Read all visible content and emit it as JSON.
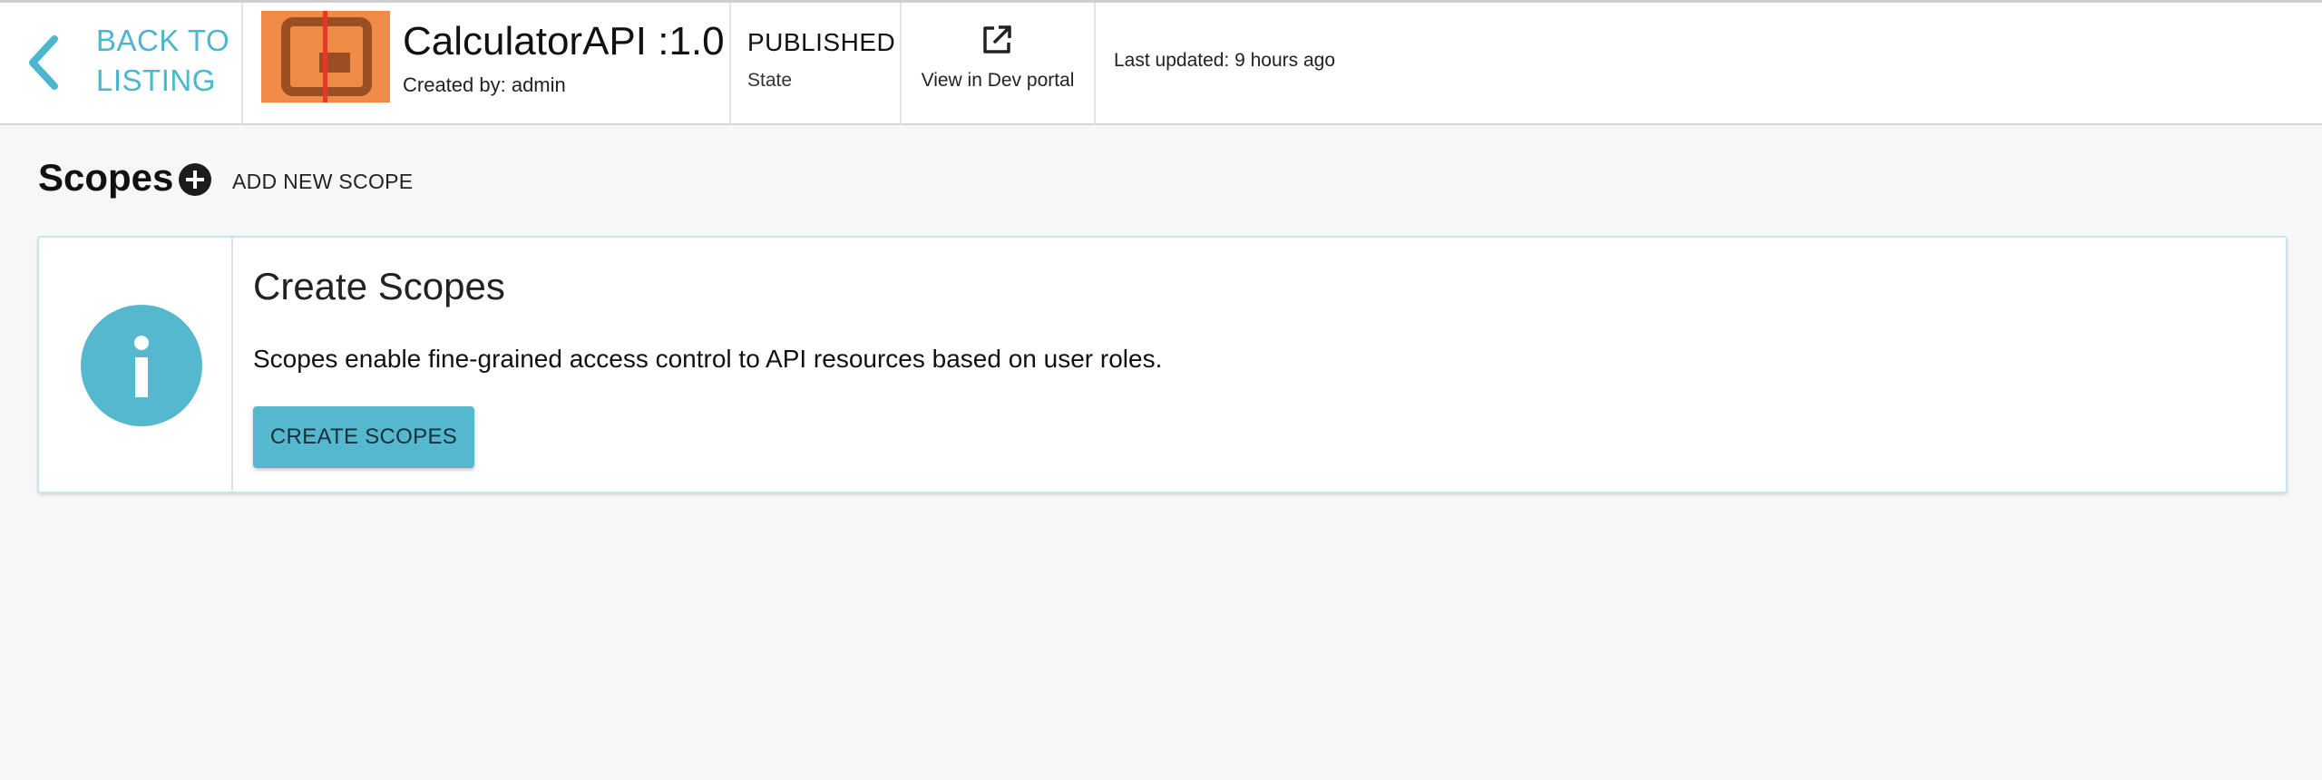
{
  "header": {
    "back_label_line1": "BACK TO",
    "back_label_line2": "LISTING",
    "api_name": "CalculatorAPI :1.0",
    "created_by": "Created by: admin",
    "state_value": "PUBLISHED",
    "state_label": "State",
    "dev_portal_label": "View in Dev portal",
    "last_updated": "Last updated: 9 hours ago"
  },
  "section": {
    "title": "Scopes",
    "add_label": "ADD NEW SCOPE"
  },
  "card": {
    "title": "Create Scopes",
    "description": "Scopes enable fine-grained access control to API resources based on user roles.",
    "button_label": "CREATE SCOPES"
  },
  "icons": {
    "back": "chevron-left-icon",
    "thumbnail": "api-thumbnail",
    "dev_portal": "external-link-icon",
    "add": "plus-circle-icon",
    "info": "info-icon"
  },
  "colors": {
    "accent": "#4db6cf",
    "button": "#56b8cf",
    "info_circle": "#56b8cf",
    "thumbnail_bg": "#f08a47",
    "background": "#f7f7f7"
  }
}
